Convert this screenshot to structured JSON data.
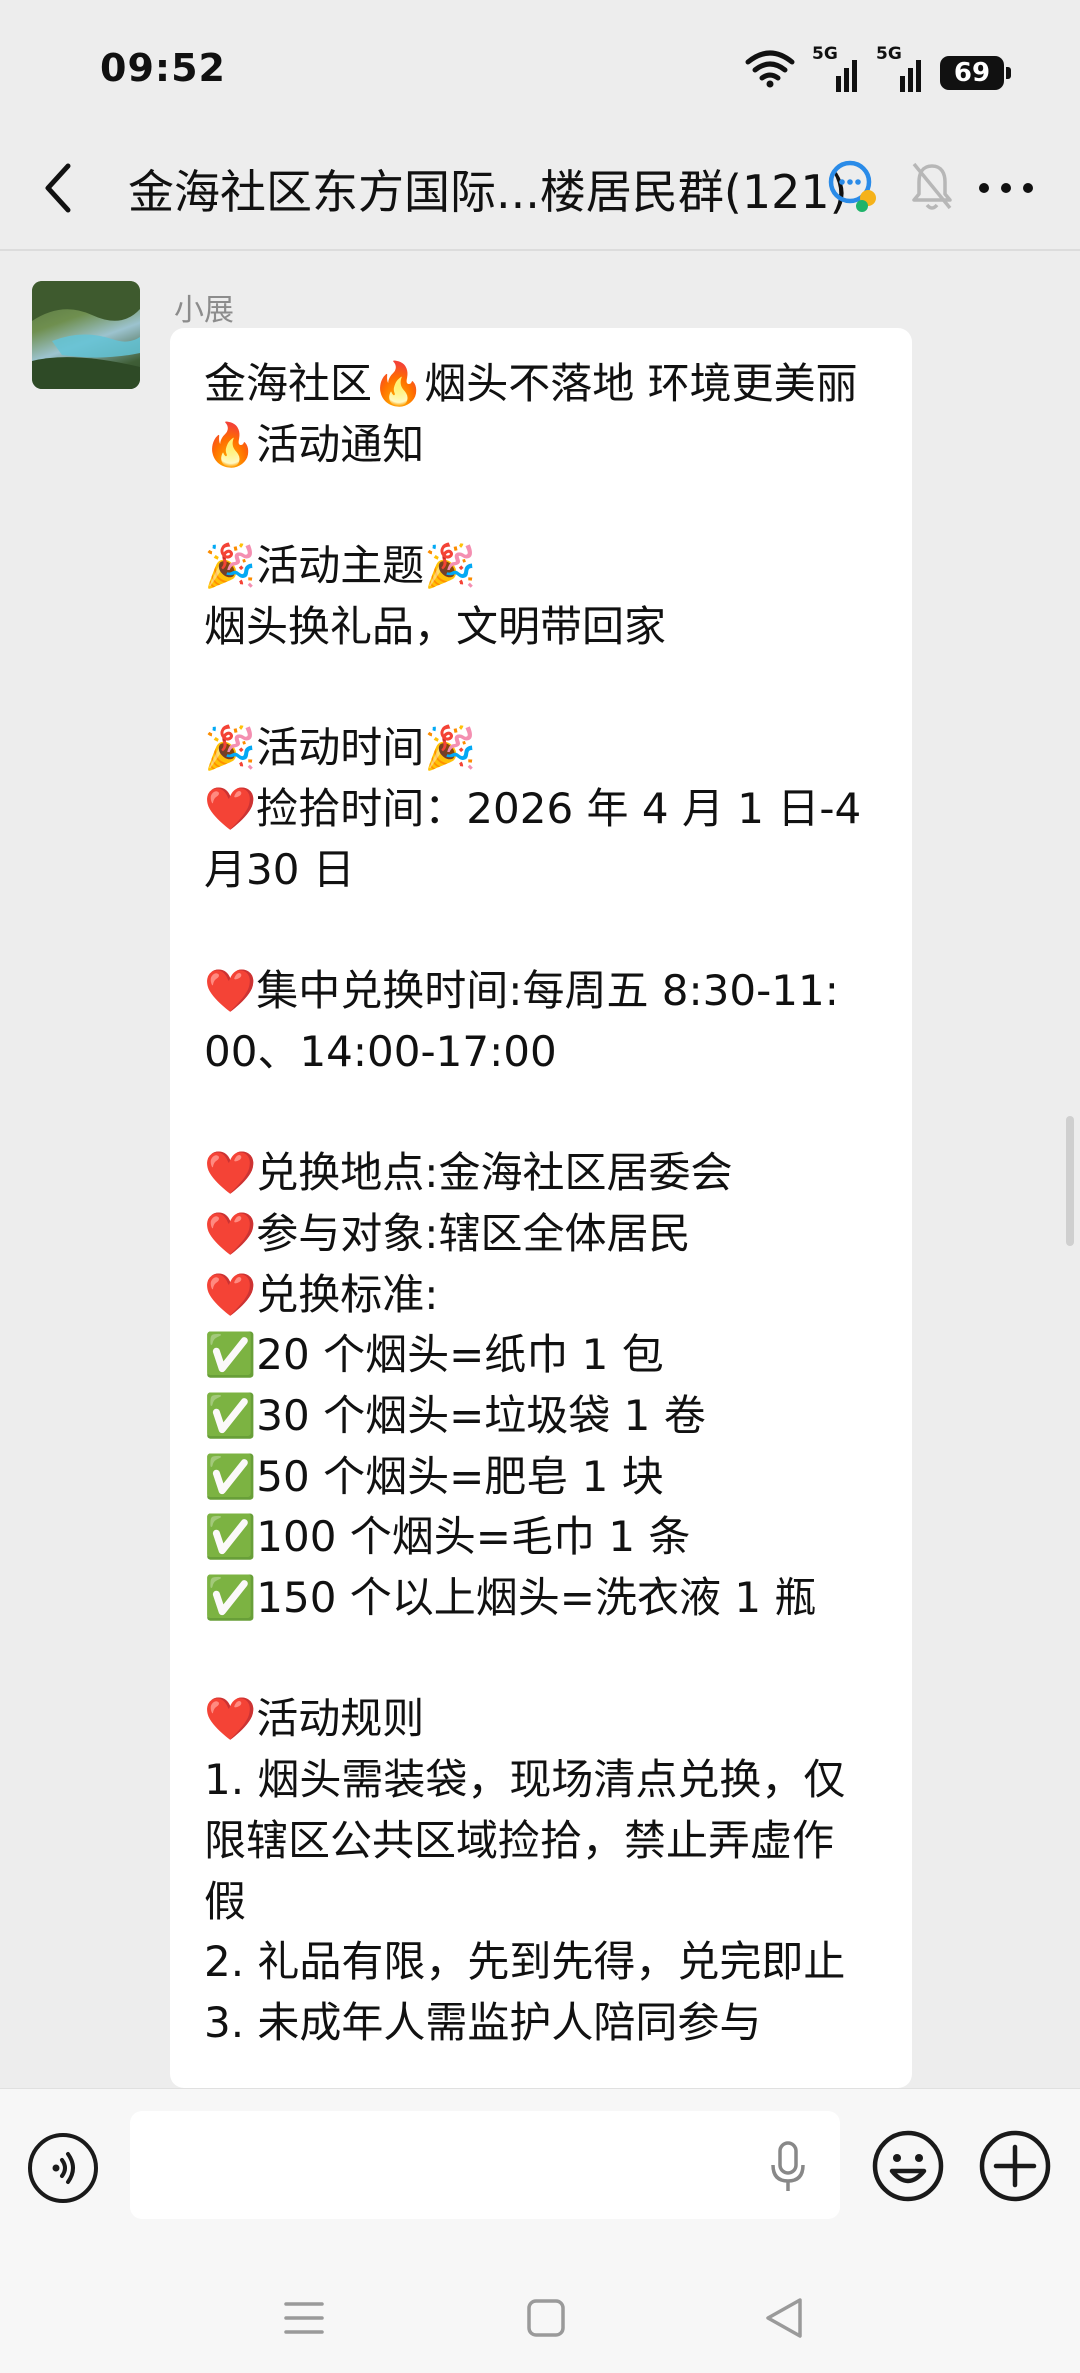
{
  "status_bar": {
    "time": "09:52",
    "signal_1_label": "5G",
    "signal_2_label": "5G",
    "battery": "69"
  },
  "header": {
    "title": "金海社区东方国际...楼居民群(121)",
    "icons": [
      "back-arrow",
      "group-chat-icon",
      "mute-bell-icon",
      "more-dots-icon"
    ]
  },
  "chat": {
    "message": {
      "sender": "小展",
      "text": "金海社区🔥烟头不落地 环境更美丽\n🔥活动通知\n\n🎉活动主题🎉\n烟头换礼品，文明带回家\n\n🎉活动时间🎉\n❤️捡拾时间：2026 年 4 月 1 日-4\n月30 日\n\n❤️集中兑换时间:每周五 8:30-11:\n00、14:00-17:00\n\n❤️兑换地点:金海社区居委会\n❤️参与对象:辖区全体居民\n❤️兑换标准:\n✅20 个烟头=纸巾 1 包\n✅30 个烟头=垃圾袋 1 卷\n✅50 个烟头=肥皂 1 块\n✅100 个烟头=毛巾 1 条\n✅150 个以上烟头=洗衣液 1 瓶\n\n❤️活动规则\n1. 烟头需装袋，现场清点兑换，仅\n限辖区公共区域捡拾，禁止弄虚作\n假\n2. 礼品有限，先到先得，兑完即止\n3. 未成年人需监护人陪同参与"
    }
  },
  "input_bar": {
    "icons": [
      "voice-icon",
      "mic-icon",
      "emoji-icon",
      "plus-icon"
    ]
  },
  "nav_bar": {
    "icons": [
      "menu-icon",
      "home-square-icon",
      "back-triangle-icon"
    ]
  },
  "colors": {
    "background": "#ededed",
    "bubble": "#ffffff",
    "text": "#111111",
    "sender": "#8c8c8c"
  }
}
